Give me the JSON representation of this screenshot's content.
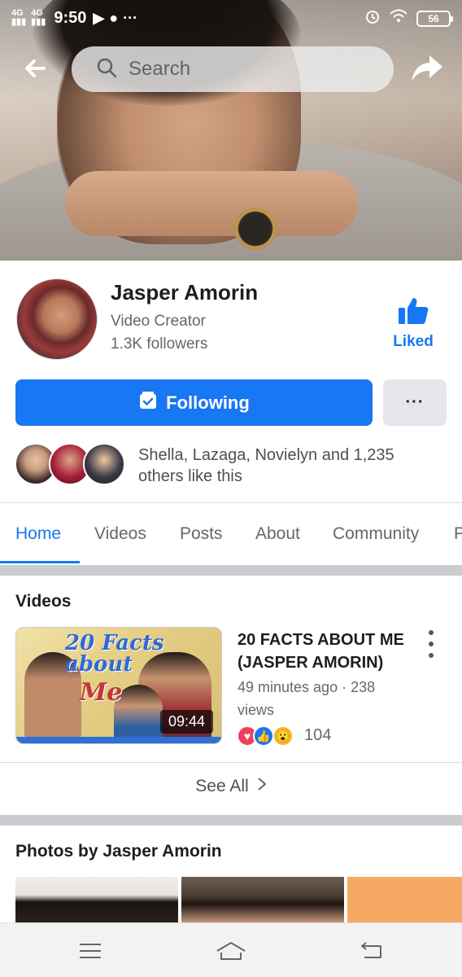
{
  "status_bar": {
    "network1": "4G",
    "network2": "4G",
    "time": "9:50",
    "battery": "56"
  },
  "search": {
    "placeholder": "Search"
  },
  "profile": {
    "name": "Jasper Amorin",
    "category": "Video Creator",
    "followers": "1.3K followers",
    "liked_label": "Liked"
  },
  "actions": {
    "following_label": "Following",
    "more_label": "···"
  },
  "social": {
    "likes_text": "Shella, Lazaga, Novielyn and 1,235 others like this"
  },
  "tabs": [
    {
      "label": "Home",
      "active": true
    },
    {
      "label": "Videos"
    },
    {
      "label": "Posts"
    },
    {
      "label": "About"
    },
    {
      "label": "Community"
    },
    {
      "label": "P"
    }
  ],
  "videos_section": {
    "title": "Videos",
    "video": {
      "thumb_text1": "20 Facts",
      "thumb_text2": "about",
      "thumb_text3": "Me",
      "duration": "09:44",
      "title": "20 FACTS ABOUT ME (JASPER AMORIN)",
      "meta": "49 minutes ago · 238 views",
      "reaction_count": "104",
      "reactions": [
        "love-icon",
        "like-icon",
        "wow-icon"
      ]
    },
    "see_all": "See All"
  },
  "photos_section": {
    "title": "Photos by Jasper Amorin"
  },
  "colors": {
    "accent": "#1877f2",
    "separator": "#c9ccd1"
  }
}
